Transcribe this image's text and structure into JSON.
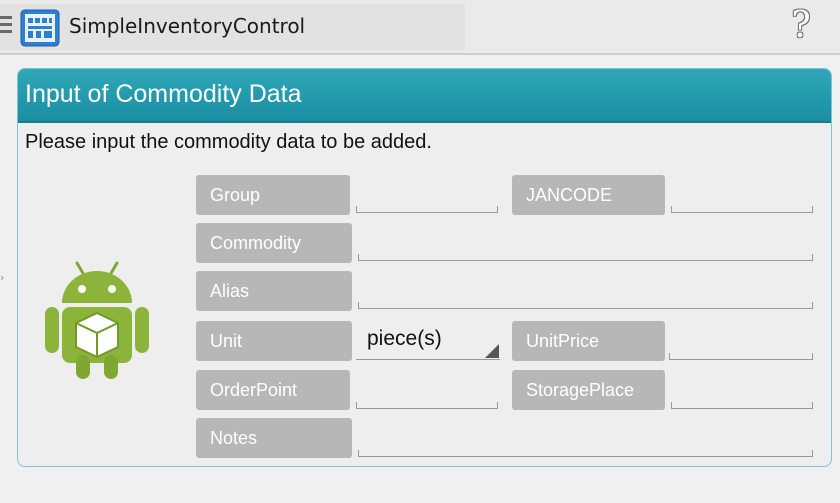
{
  "app": {
    "title": "SimpleInventoryControl",
    "help_glyph": "?"
  },
  "panel": {
    "title": "Input of Commodity Data",
    "description": "Please input the commodity data to be added."
  },
  "form": {
    "group_label": "Group",
    "group_value": "",
    "jancode_label": "JANCODE",
    "jancode_value": "",
    "commodity_label": "Commodity",
    "commodity_value": "",
    "alias_label": "Alias",
    "alias_value": "",
    "unit_label": "Unit",
    "unit_value": "piece(s)",
    "unitprice_label": "UnitPrice",
    "unitprice_value": "",
    "orderpoint_label": "OrderPoint",
    "orderpoint_value": "",
    "storageplace_label": "StoragePlace",
    "storageplace_value": "",
    "notes_label": "Notes",
    "notes_value": ""
  },
  "icons": {
    "menu": "menu-icon",
    "app": "inventory-app-icon",
    "help": "help-icon",
    "android": "android-box-icon"
  },
  "colors": {
    "header": "#1b8ea3",
    "label_bg": "#b7b7b7",
    "android_green": "#8cb33a"
  }
}
